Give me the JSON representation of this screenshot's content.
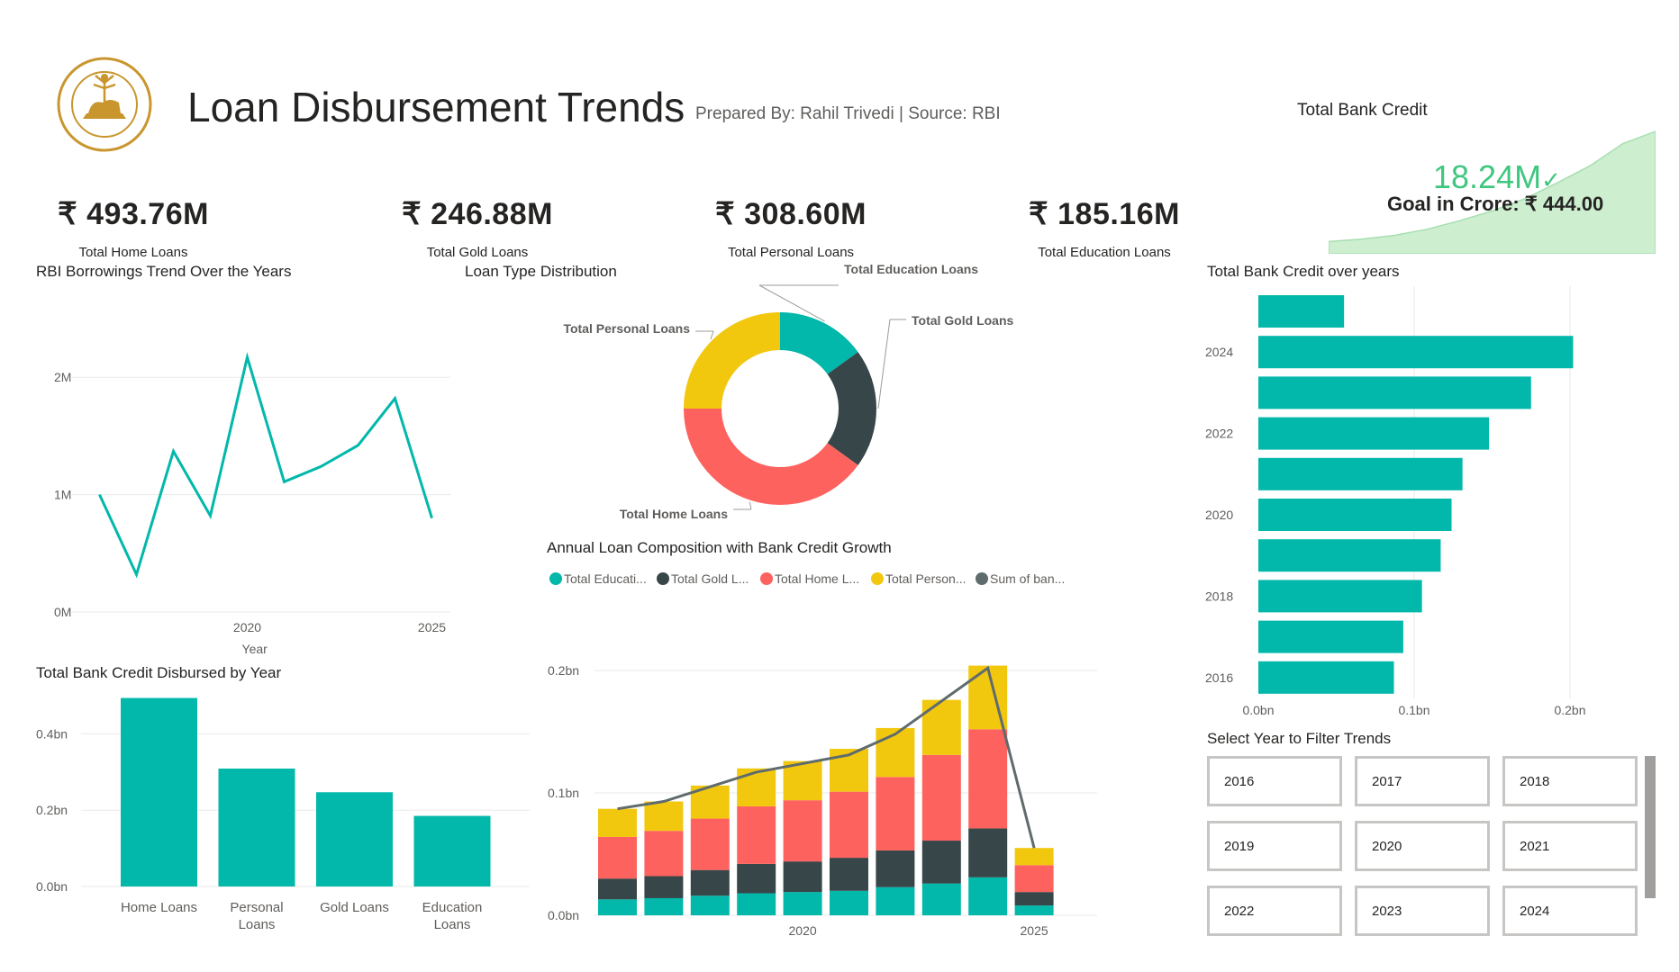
{
  "header": {
    "title": "Loan Disbursement Trends",
    "subtitle": "Prepared By: Rahil Trivedi | Source: RBI",
    "logo_text": "भारतीय रिज़र्व बैंक • RESERVE BANK OF INDIA"
  },
  "kpis": [
    {
      "value": "₹ 493.76M",
      "label": "Total Home Loans"
    },
    {
      "value": "₹ 246.88M",
      "label": "Total Gold Loans"
    },
    {
      "value": "₹ 308.60M",
      "label": "Total Personal Loans"
    },
    {
      "value": "₹ 185.16M",
      "label": "Total Education Loans"
    }
  ],
  "bank_credit_card": {
    "title": "Total Bank Credit",
    "value": "18.24M",
    "check": "✓",
    "goal": "Goal in Crore: ₹ 444.00"
  },
  "colors": {
    "teal": "#01b8aa",
    "dark": "#374649",
    "red": "#fd625e",
    "yellow": "#f2c80f",
    "grey": "#5f6b6d",
    "green_area": "#cdeecf"
  },
  "charts": {
    "rbi_trend": {
      "title": "RBI Borrowings Trend Over the Years"
    },
    "distribution": {
      "title": "Loan Type Distribution"
    },
    "credit_years": {
      "title": "Total Bank Credit over years"
    },
    "disbursed": {
      "title": "Total Bank Credit Disbursed by Year"
    },
    "composition": {
      "title": "Annual Loan Composition with Bank Credit Growth"
    }
  },
  "slicer": {
    "title": "Select Year to Filter Trends",
    "years": [
      "2016",
      "2017",
      "2018",
      "2019",
      "2020",
      "2021",
      "2022",
      "2023",
      "2024"
    ]
  },
  "chart_data": [
    {
      "id": "rbi_trend",
      "type": "line",
      "title": "RBI Borrowings Trend Over the Years",
      "xlabel": "Year",
      "ylabel": "",
      "x": [
        2015,
        2016,
        2017,
        2018,
        2019,
        2020,
        2021,
        2022,
        2023,
        2024,
        2025
      ],
      "values": [
        1.0,
        0.32,
        1.37,
        0.82,
        2.17,
        1.11,
        1.24,
        1.42,
        1.82,
        0.8
      ],
      "x_points": [
        2016,
        2017,
        2018,
        2019,
        2020,
        2021,
        2022,
        2023,
        2024,
        2025
      ],
      "x_ticks": [
        "2020",
        "2025"
      ],
      "y_ticks": [
        "0M",
        "1M",
        "2M"
      ],
      "ylim": [
        0,
        2.5
      ],
      "grid": true
    },
    {
      "id": "distribution",
      "type": "pie",
      "title": "Loan Type Distribution",
      "categories": [
        "Total Education Loans",
        "Total Gold Loans",
        "Total Home Loans",
        "Total Personal Loans"
      ],
      "values": [
        185.16,
        246.88,
        493.76,
        308.6
      ]
    },
    {
      "id": "credit_years",
      "type": "bar",
      "title": "Total Bank Credit over years",
      "categories": [
        "2016",
        "2017",
        "2018",
        "2019",
        "2020",
        "2021",
        "2022",
        "2023",
        "2024",
        "2025"
      ],
      "values": [
        0.087,
        0.093,
        0.105,
        0.117,
        0.124,
        0.131,
        0.148,
        0.175,
        0.202,
        0.055
      ],
      "y_ticks": [
        "2016",
        "2018",
        "2020",
        "2022",
        "2024"
      ],
      "x_ticks": [
        "0.0bn",
        "0.1bn",
        "0.2bn"
      ],
      "xlim": [
        0,
        0.25
      ],
      "grid": true
    },
    {
      "id": "disbursed",
      "type": "bar",
      "title": "Total Bank Credit Disbursed by Year",
      "categories": [
        "Home Loans",
        "Personal Loans",
        "Gold Loans",
        "Education Loans"
      ],
      "category_lines": [
        [
          "Home Loans"
        ],
        [
          "Personal",
          "Loans"
        ],
        [
          "Gold Loans"
        ],
        [
          "Education",
          "Loans"
        ]
      ],
      "values": [
        0.494,
        0.309,
        0.247,
        0.185
      ],
      "y_ticks": [
        "0.0bn",
        "0.2bn",
        "0.4bn"
      ],
      "ylim": [
        0,
        0.6
      ],
      "grid": true
    },
    {
      "id": "composition",
      "type": "bar",
      "title": "Annual Loan Composition with Bank Credit Growth",
      "categories": [
        "2016",
        "2017",
        "2018",
        "2019",
        "2020",
        "2021",
        "2022",
        "2023",
        "2024",
        "2025"
      ],
      "x_ticks": [
        "2020",
        "2025"
      ],
      "legend": [
        "Total Educati...",
        "Total Gold L...",
        "Total Home L...",
        "Total Person...",
        "Sum of ban..."
      ],
      "series": [
        {
          "name": "Total Education Loans",
          "values": [
            0.013,
            0.014,
            0.016,
            0.018,
            0.019,
            0.02,
            0.023,
            0.026,
            0.031,
            0.008
          ]
        },
        {
          "name": "Total Gold Loans",
          "values": [
            0.017,
            0.018,
            0.021,
            0.024,
            0.025,
            0.027,
            0.03,
            0.035,
            0.04,
            0.011
          ]
        },
        {
          "name": "Total Home Loans",
          "values": [
            0.034,
            0.037,
            0.042,
            0.047,
            0.05,
            0.054,
            0.06,
            0.07,
            0.081,
            0.022
          ]
        },
        {
          "name": "Total Personal Loans",
          "values": [
            0.023,
            0.024,
            0.027,
            0.031,
            0.032,
            0.035,
            0.04,
            0.045,
            0.052,
            0.014
          ]
        },
        {
          "name": "Sum of bank credit",
          "values": [
            0.087,
            0.093,
            0.105,
            0.117,
            0.124,
            0.131,
            0.148,
            0.175,
            0.202,
            0.055
          ]
        }
      ],
      "y_ticks": [
        "0.0bn",
        "0.1bn",
        "0.2bn"
      ],
      "ylim": [
        0,
        0.22
      ],
      "grid": true
    },
    {
      "id": "bank_credit_area",
      "type": "area",
      "values": [
        0.1,
        0.12,
        0.15,
        0.2,
        0.27,
        0.35,
        0.45,
        0.58,
        0.72,
        0.9,
        1.0
      ]
    }
  ]
}
